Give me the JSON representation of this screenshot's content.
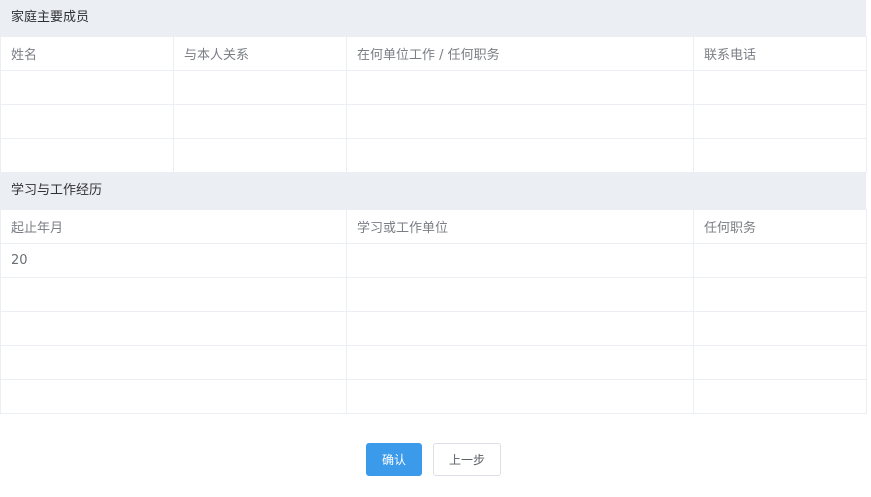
{
  "family": {
    "title": "家庭主要成员",
    "headers": [
      "姓名",
      "与本人关系",
      "在何单位工作 / 任何职务",
      "联系电话"
    ],
    "rows": [
      [
        "",
        "",
        "",
        ""
      ],
      [
        "",
        "",
        "",
        ""
      ],
      [
        "",
        "",
        "",
        ""
      ]
    ]
  },
  "history": {
    "title": "学习与工作经历",
    "headers": [
      "起止年月",
      "学习或工作单位",
      "任何职务"
    ],
    "rows": [
      [
        "20",
        "",
        ""
      ],
      [
        "",
        "",
        ""
      ],
      [
        "",
        "",
        ""
      ],
      [
        "",
        "",
        ""
      ],
      [
        "",
        "",
        ""
      ]
    ]
  },
  "actions": {
    "confirm_label": "确认",
    "back_label": "上一步"
  },
  "colors": {
    "primary": "#3c9aea",
    "section_bg": "#ebeef3"
  }
}
